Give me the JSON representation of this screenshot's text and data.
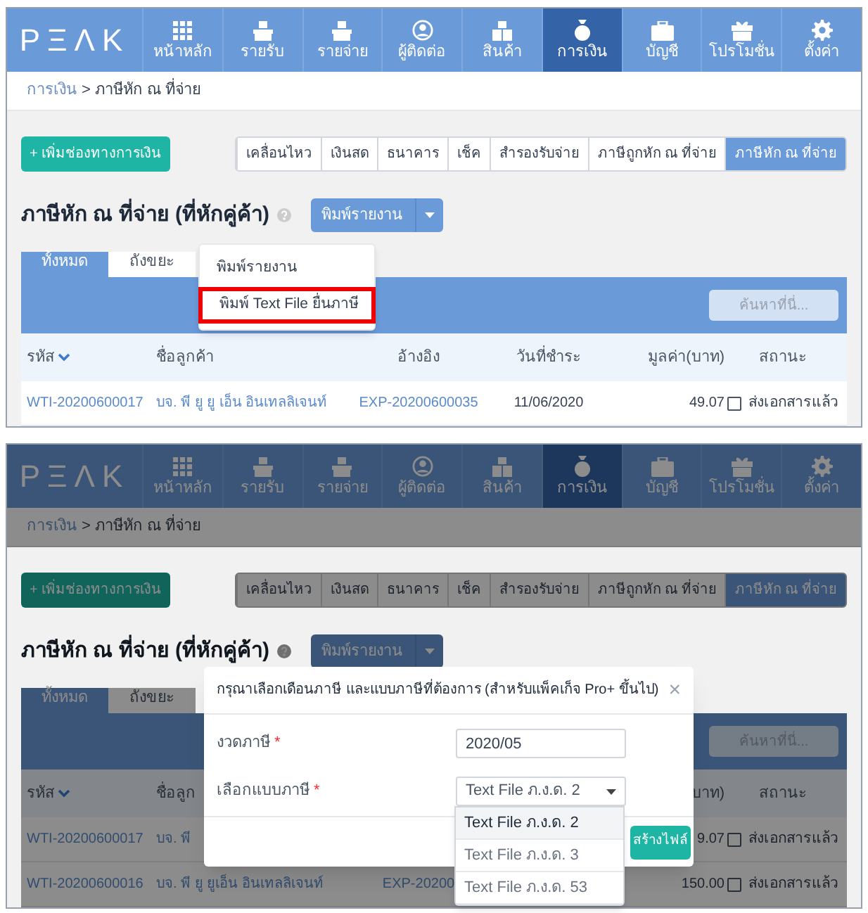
{
  "screens": [
    {
      "dimmed": false,
      "logo": "PΞΛK",
      "nav": [
        {
          "label": "หน้าหลัก",
          "selected": false
        },
        {
          "label": "รายรับ",
          "selected": false
        },
        {
          "label": "รายจ่าย",
          "selected": false
        },
        {
          "label": "ผู้ติดต่อ",
          "selected": false
        },
        {
          "label": "สินค้า",
          "selected": false
        },
        {
          "label": "การเงิน",
          "selected": true
        },
        {
          "label": "บัญชี",
          "selected": false
        },
        {
          "label": "โปรโมชั่น",
          "selected": false
        },
        {
          "label": "ตั้งค่า",
          "selected": false
        }
      ],
      "breadcrumb": {
        "link": "การเงิน",
        "current": "> ภาษีหัก ณ ที่จ่าย"
      },
      "add_button": "+ เพิ่มช่องทางการเงิน",
      "tabs": [
        {
          "label": "เคลื่อนไหว",
          "selected": false
        },
        {
          "label": "เงินสด",
          "selected": false
        },
        {
          "label": "ธนาคาร",
          "selected": false
        },
        {
          "label": "เช็ค",
          "selected": false
        },
        {
          "label": "สำรองรับจ่าย",
          "selected": false
        },
        {
          "label": "ภาษีถูกหัก ณ ที่จ่าย",
          "selected": false
        },
        {
          "label": "ภาษีหัก ณ ที่จ่าย",
          "selected": true
        }
      ],
      "heading": "ภาษีหัก ณ ที่จ่าย (ที่หักคู่ค้า)",
      "print_button": "พิมพ์รายงาน",
      "list_tabs": [
        {
          "label": "ทั้งหมด",
          "selected": true
        },
        {
          "label": "ถังขยะ",
          "selected": false
        }
      ],
      "search": {
        "placeholder": "ค้นหาที่นี่..."
      },
      "columns": [
        "รหัส",
        "ชื่อลูกค้า",
        "อ้างอิง",
        "วันที่ชำระ",
        "มูลค่า(บาท)",
        "สถานะ"
      ],
      "rows": [
        {
          "code": "WTI-20200600017",
          "customer": "บจ. พี ยู ยู เอ็น อินเทลลิเจนท์",
          "reference": "EXP-20200600035",
          "date": "11/06/2020",
          "amount": "49.07",
          "status": "ส่งเอกสารแล้ว",
          "checked": false
        }
      ],
      "menu": {
        "items": [
          {
            "label": "พิมพ์รายงาน",
            "highlighted": false
          },
          {
            "label": "พิมพ์ Text File ยื่นภาษี",
            "highlighted": true
          }
        ]
      }
    },
    {
      "dimmed": true,
      "logo": "PΞΛK",
      "nav": [
        {
          "label": "หน้าหลัก",
          "selected": false
        },
        {
          "label": "รายรับ",
          "selected": false
        },
        {
          "label": "รายจ่าย",
          "selected": false
        },
        {
          "label": "ผู้ติดต่อ",
          "selected": false
        },
        {
          "label": "สินค้า",
          "selected": false
        },
        {
          "label": "การเงิน",
          "selected": true
        },
        {
          "label": "บัญชี",
          "selected": false
        },
        {
          "label": "โปรโมชั่น",
          "selected": false
        },
        {
          "label": "ตั้งค่า",
          "selected": false
        }
      ],
      "breadcrumb": {
        "link": "การเงิน",
        "current": "> ภาษีหัก ณ ที่จ่าย"
      },
      "add_button": "+ เพิ่มช่องทางการเงิน",
      "tabs": [
        {
          "label": "เคลื่อนไหว",
          "selected": false
        },
        {
          "label": "เงินสด",
          "selected": false
        },
        {
          "label": "ธนาคาร",
          "selected": false
        },
        {
          "label": "เช็ค",
          "selected": false
        },
        {
          "label": "สำรองรับจ่าย",
          "selected": false
        },
        {
          "label": "ภาษีถูกหัก ณ ที่จ่าย",
          "selected": false
        },
        {
          "label": "ภาษีหัก ณ ที่จ่าย",
          "selected": true
        }
      ],
      "heading": "ภาษีหัก ณ ที่จ่าย (ที่หักคู่ค้า)",
      "print_button": "พิมพ์รายงาน",
      "list_tabs": [
        {
          "label": "ทั้งหมด",
          "selected": true
        },
        {
          "label": "ถังขยะ",
          "selected": false
        }
      ],
      "search": {
        "placeholder": "ค้นหาที่นี่..."
      },
      "columns": [
        "รหัส",
        "ชื่อลูก",
        null,
        null,
        "บาท)",
        "สถานะ"
      ],
      "rows": [
        {
          "code": "WTI-20200600017",
          "customer": "บจ. พี",
          "amount": "9.07",
          "status": "ส่งเอกสารแล้ว",
          "checked": false
        },
        {
          "code": "WTI-20200600016",
          "customer": "บจ. พี ยู ยูเอ็น อินเทลลิเจนท์",
          "reference": "EXP-20200",
          "amount": "150.00",
          "status": "ส่งเอกสารแล้ว",
          "checked": false
        }
      ],
      "modal": {
        "title": "กรุณาเลือกเดือนภาษี และแบบภาษีที่ต้องการ (สำหรับแพ็คเก็จ Pro+ ขึ้นไป)",
        "close": "×",
        "fields": [
          {
            "kind": "input",
            "label": "งวดภาษี",
            "required_mark": "*",
            "value": "2020/05"
          },
          {
            "kind": "select",
            "label": "เลือกแบบภาษี",
            "required_mark": "*",
            "value": "Text File ภ.ง.ด. 2",
            "expanded": true,
            "options": [
              {
                "label": "Text File ภ.ง.ด. 2",
                "selected": true
              },
              {
                "label": "Text File ภ.ง.ด. 3",
                "selected": false
              },
              {
                "label": "Text File ภ.ง.ด. 53",
                "selected": false
              }
            ]
          }
        ],
        "button": "สร้างไฟล์"
      }
    }
  ]
}
